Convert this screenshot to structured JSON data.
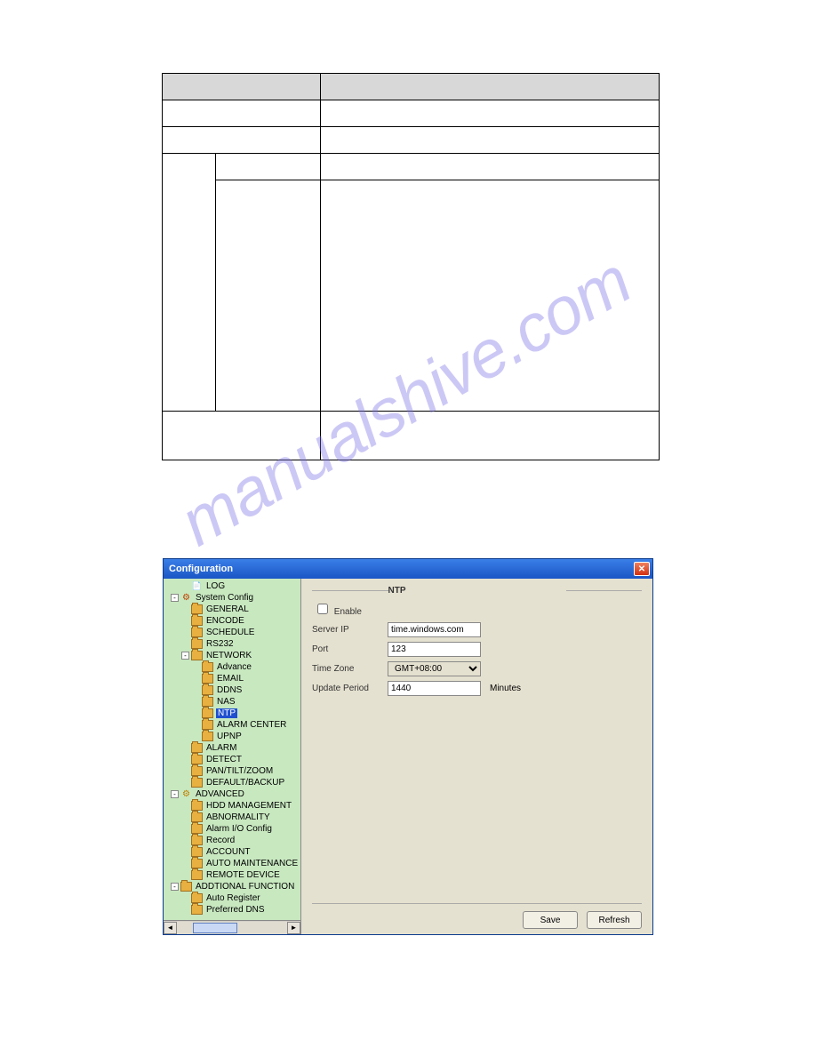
{
  "docTable": {
    "headers": [
      "",
      "",
      ""
    ]
  },
  "window": {
    "title": "Configuration"
  },
  "tree": {
    "items": [
      {
        "depth": 2,
        "toggle": null,
        "icon": "log",
        "label": "LOG",
        "sel": false
      },
      {
        "depth": 1,
        "toggle": "-",
        "icon": "cfg",
        "label": "System Config",
        "sel": false
      },
      {
        "depth": 2,
        "toggle": null,
        "icon": "folder",
        "label": "GENERAL",
        "sel": false
      },
      {
        "depth": 2,
        "toggle": null,
        "icon": "folder",
        "label": "ENCODE",
        "sel": false
      },
      {
        "depth": 2,
        "toggle": null,
        "icon": "folder",
        "label": "SCHEDULE",
        "sel": false
      },
      {
        "depth": 2,
        "toggle": null,
        "icon": "folder",
        "label": "RS232",
        "sel": false
      },
      {
        "depth": 2,
        "toggle": "-",
        "icon": "folder",
        "label": "NETWORK",
        "sel": false
      },
      {
        "depth": 3,
        "toggle": null,
        "icon": "folder",
        "label": "Advance",
        "sel": false
      },
      {
        "depth": 3,
        "toggle": null,
        "icon": "folder",
        "label": "EMAIL",
        "sel": false
      },
      {
        "depth": 3,
        "toggle": null,
        "icon": "folder",
        "label": "DDNS",
        "sel": false
      },
      {
        "depth": 3,
        "toggle": null,
        "icon": "folder",
        "label": "NAS",
        "sel": false
      },
      {
        "depth": 3,
        "toggle": null,
        "icon": "folder",
        "label": "NTP",
        "sel": true
      },
      {
        "depth": 3,
        "toggle": null,
        "icon": "folder",
        "label": "ALARM CENTER",
        "sel": false
      },
      {
        "depth": 3,
        "toggle": null,
        "icon": "folder",
        "label": "UPNP",
        "sel": false
      },
      {
        "depth": 2,
        "toggle": null,
        "icon": "folder",
        "label": "ALARM",
        "sel": false
      },
      {
        "depth": 2,
        "toggle": null,
        "icon": "folder",
        "label": "DETECT",
        "sel": false
      },
      {
        "depth": 2,
        "toggle": null,
        "icon": "folder",
        "label": "PAN/TILT/ZOOM",
        "sel": false
      },
      {
        "depth": 2,
        "toggle": null,
        "icon": "folder",
        "label": "DEFAULT/BACKUP",
        "sel": false
      },
      {
        "depth": 1,
        "toggle": "-",
        "icon": "adv",
        "label": "ADVANCED",
        "sel": false
      },
      {
        "depth": 2,
        "toggle": null,
        "icon": "folder",
        "label": "HDD MANAGEMENT",
        "sel": false
      },
      {
        "depth": 2,
        "toggle": null,
        "icon": "folder",
        "label": "ABNORMALITY",
        "sel": false
      },
      {
        "depth": 2,
        "toggle": null,
        "icon": "folder",
        "label": "Alarm I/O Config",
        "sel": false
      },
      {
        "depth": 2,
        "toggle": null,
        "icon": "folder",
        "label": "Record",
        "sel": false
      },
      {
        "depth": 2,
        "toggle": null,
        "icon": "folder",
        "label": "ACCOUNT",
        "sel": false
      },
      {
        "depth": 2,
        "toggle": null,
        "icon": "folder",
        "label": "AUTO MAINTENANCE",
        "sel": false
      },
      {
        "depth": 2,
        "toggle": null,
        "icon": "folder",
        "label": "REMOTE DEVICE",
        "sel": false
      },
      {
        "depth": 1,
        "toggle": "-",
        "icon": "folder",
        "label": "ADDTIONAL FUNCTION",
        "sel": false
      },
      {
        "depth": 2,
        "toggle": null,
        "icon": "folder",
        "label": "Auto Register",
        "sel": false
      },
      {
        "depth": 2,
        "toggle": null,
        "icon": "folder",
        "label": "Preferred DNS",
        "sel": false
      }
    ]
  },
  "form": {
    "groupTitle": "NTP",
    "enableLabel": "Enable",
    "enableChecked": false,
    "serverIpLabel": "Server IP",
    "serverIpValue": "time.windows.com",
    "portLabel": "Port",
    "portValue": "123",
    "timeZoneLabel": "Time Zone",
    "timeZoneValue": "GMT+08:00",
    "updatePeriodLabel": "Update Period",
    "updatePeriodValue": "1440",
    "updatePeriodSuffix": "Minutes",
    "saveLabel": "Save",
    "refreshLabel": "Refresh"
  }
}
